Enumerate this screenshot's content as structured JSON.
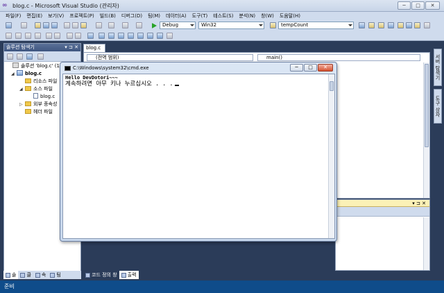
{
  "window": {
    "title": "blog.c - Microsoft Visual Studio (관리자)",
    "caption_buttons": [
      "─",
      "□",
      "✕"
    ]
  },
  "menu": [
    "파일(F)",
    "편집(E)",
    "보기(V)",
    "프로젝트(P)",
    "빌드(B)",
    "디버그(D)",
    "팀(M)",
    "데이터(A)",
    "도구(T)",
    "테스트(S)",
    "분석(N)",
    "창(W)",
    "도움말(H)"
  ],
  "toolbar": {
    "configuration": "Debug",
    "platform": "Win32",
    "find_text": "tempCount"
  },
  "solution_explorer": {
    "title": "솔루션 탐색기",
    "pin_glyphs": "▾ ⊐ ✕",
    "tree": [
      {
        "label": "솔루션 'blog.c' (1",
        "level": 0,
        "icon": "solution-icon",
        "expander": ""
      },
      {
        "label": "blog.c",
        "level": 1,
        "icon": "project-icon",
        "expander": "◢"
      },
      {
        "label": "리소스 파일",
        "level": 2,
        "icon": "folder-icon",
        "expander": ""
      },
      {
        "label": "소스 파일",
        "level": 2,
        "icon": "folder-icon",
        "expander": "◢"
      },
      {
        "label": "blog.c",
        "level": 3,
        "icon": "file-icon",
        "expander": ""
      },
      {
        "label": "외부 종속성",
        "level": 2,
        "icon": "folder-icon",
        "expander": "▷"
      },
      {
        "label": "헤더 파일",
        "level": 2,
        "icon": "folder-icon",
        "expander": ""
      }
    ]
  },
  "left_tabs": [
    "솔",
    "클",
    "속",
    "팀"
  ],
  "editor": {
    "tab": "blog.c",
    "scope": "(전역 범위)",
    "member": "main()"
  },
  "bottom_tabs": [
    "코드 정의 창",
    "출력"
  ],
  "right_tabs": [
    "서버 탐색기",
    "도구 상자"
  ],
  "output_panel": {
    "pin_glyphs": "▾ ⊐ ✕"
  },
  "status": "준비",
  "console": {
    "title": "C:\\Windows\\system32\\cmd.exe",
    "line1": "Hello DevDotori~~~",
    "line2": "계속하려면 아무 키나 누르십시오 . . ."
  }
}
